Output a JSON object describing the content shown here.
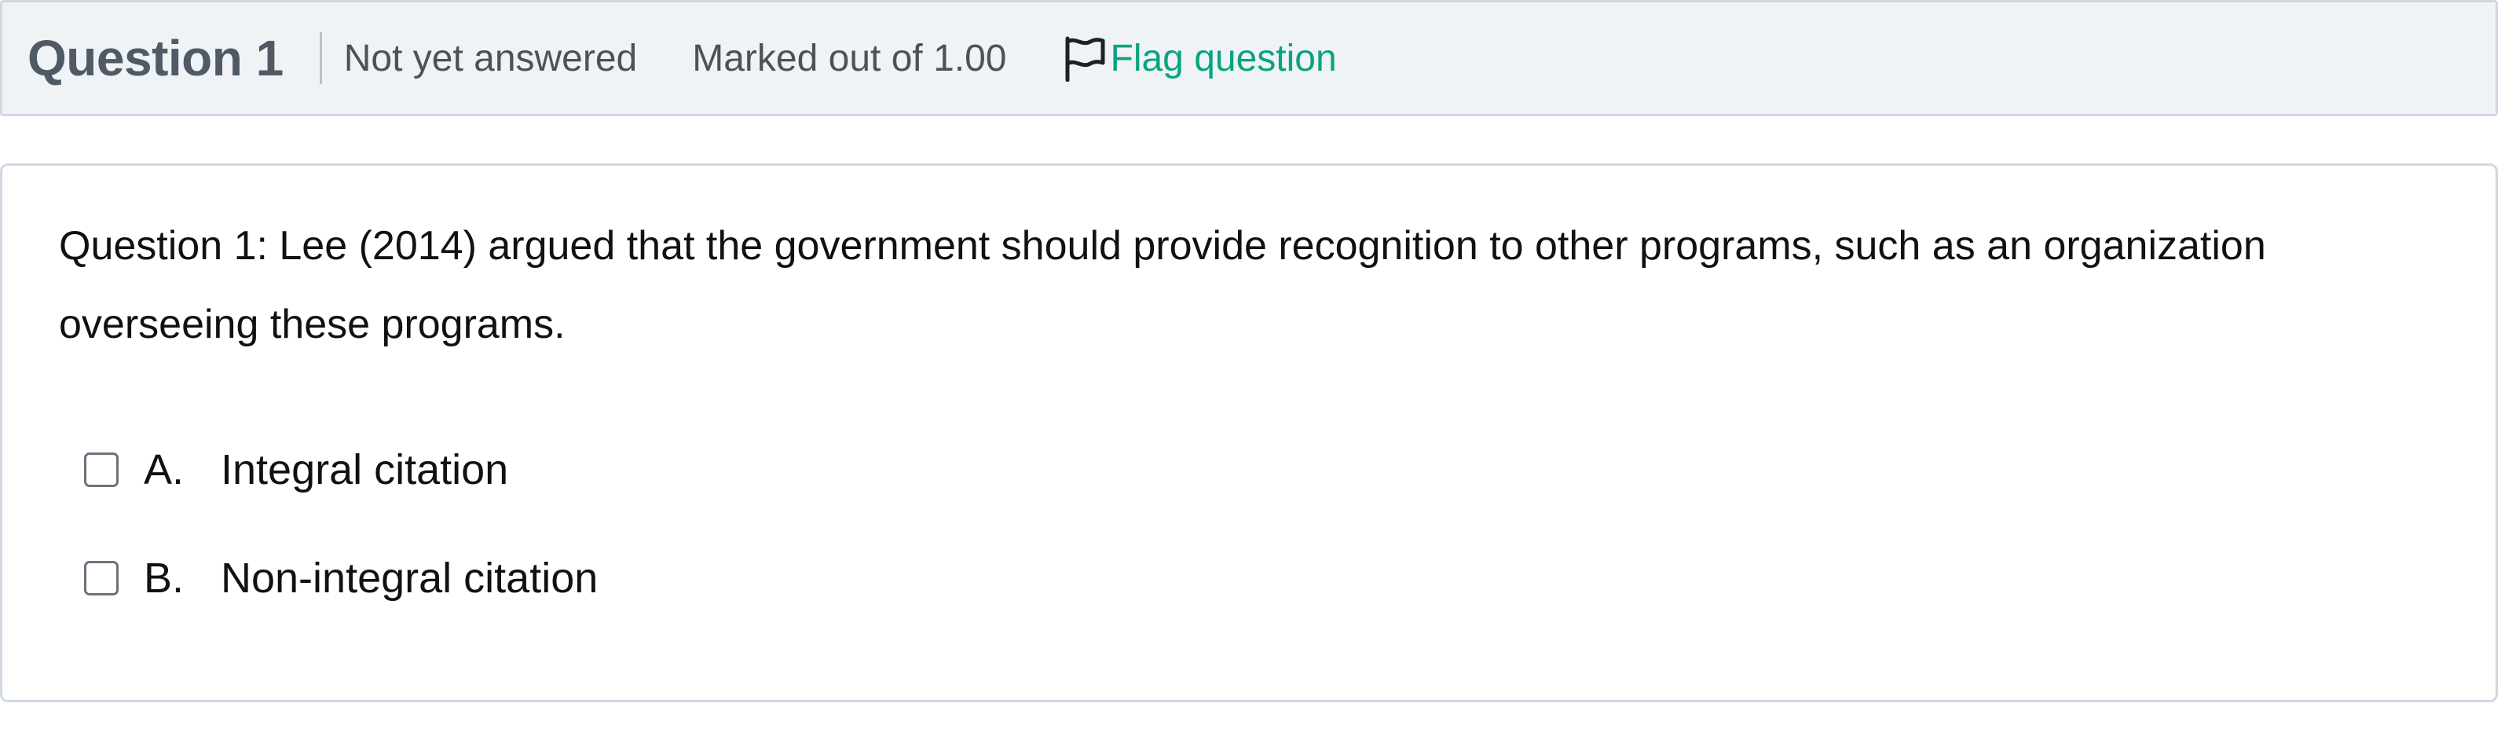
{
  "header": {
    "title": "Question 1",
    "state": "Not yet answered",
    "grade": "Marked out of 1.00",
    "flag_label": "Flag question",
    "flag_icon": "flag-icon",
    "accent_color": "#0ba37f"
  },
  "question": {
    "text": "Question 1: Lee (2014) argued that the government should provide recognition to other programs, such as an organization overseeing these programs.",
    "answers": [
      {
        "letter": "A.",
        "label": "Integral citation",
        "checked": false
      },
      {
        "letter": "B.",
        "label": "Non-integral citation",
        "checked": false
      }
    ]
  }
}
